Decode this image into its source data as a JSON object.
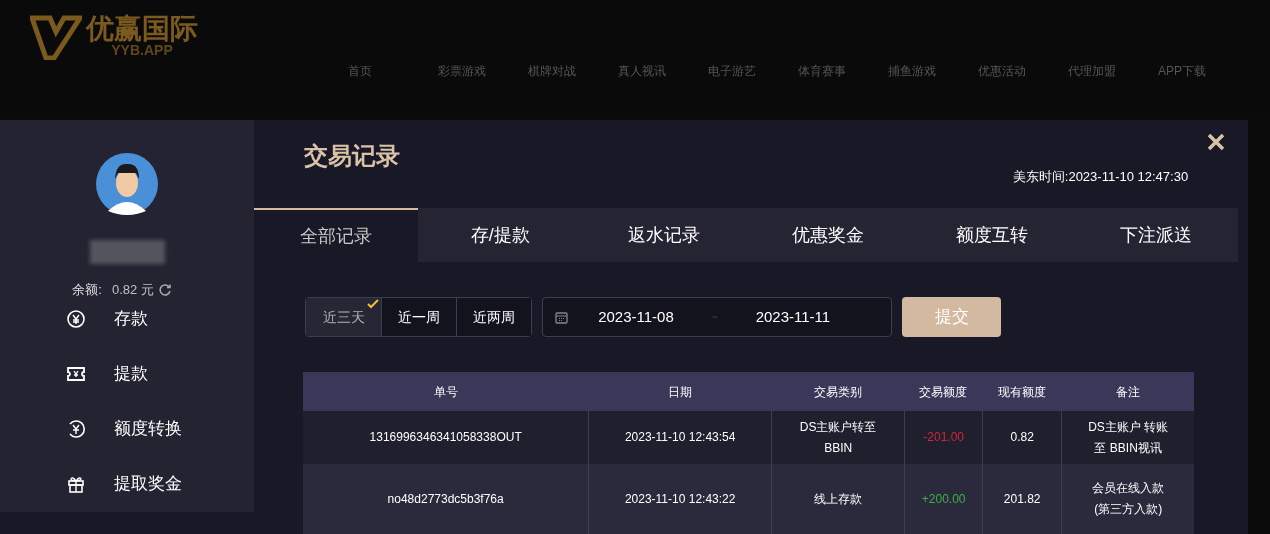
{
  "site_header": {
    "logo_text": "优赢国际",
    "logo_subtext": "YYB.APP",
    "nav": [
      "首页",
      "彩票游戏",
      "棋牌对战",
      "真人视讯",
      "电子游艺",
      "体育赛事",
      "捕鱼游戏",
      "优惠活动",
      "代理加盟",
      "APP下载"
    ]
  },
  "sidebar": {
    "balance_label": "余额:",
    "balance_value": "0.82 元",
    "items": [
      {
        "label": "存款",
        "kind": "deposit"
      },
      {
        "label": "提款",
        "kind": "withdraw"
      },
      {
        "label": "额度转换",
        "kind": "transfer"
      },
      {
        "label": "提取奖金",
        "kind": "bonus"
      }
    ]
  },
  "main": {
    "title": "交易记录",
    "time_label": "美东时间:",
    "time_value": "2023-11-10 12:47:30",
    "tabs": [
      {
        "label": "全部记录",
        "selected": true
      },
      {
        "label": "存/提款",
        "selected": false
      },
      {
        "label": "返水记录",
        "selected": false
      },
      {
        "label": "优惠奖金",
        "selected": false
      },
      {
        "label": "额度互转",
        "selected": false
      },
      {
        "label": "下注派送",
        "selected": false
      }
    ],
    "ranges": [
      {
        "label": "近三天",
        "selected": true
      },
      {
        "label": "近一周",
        "selected": false
      },
      {
        "label": "近两周",
        "selected": false
      }
    ],
    "date_from": "2023-11-08",
    "date_separator": "~",
    "date_to": "2023-11-11",
    "submit": "提交",
    "table": {
      "columns": [
        "单号",
        "日期",
        "交易类别",
        "交易额度",
        "现有额度",
        "备注"
      ],
      "rows": [
        {
          "cells": [
            "1316996346341058338OUT",
            "2023-11-10 12:43:54",
            "DS主账户转至BBIN",
            "-201.00",
            "0.82",
            "DS主账户 转账至 BBIN视讯"
          ],
          "kind": "debit"
        },
        {
          "cells": [
            "no48d2773dc5b3f76a",
            "2023-11-10 12:43:22",
            "线上存款",
            "+200.00",
            "201.82",
            "会员在线入款(第三方入款)"
          ],
          "kind": "credit"
        }
      ]
    }
  }
}
